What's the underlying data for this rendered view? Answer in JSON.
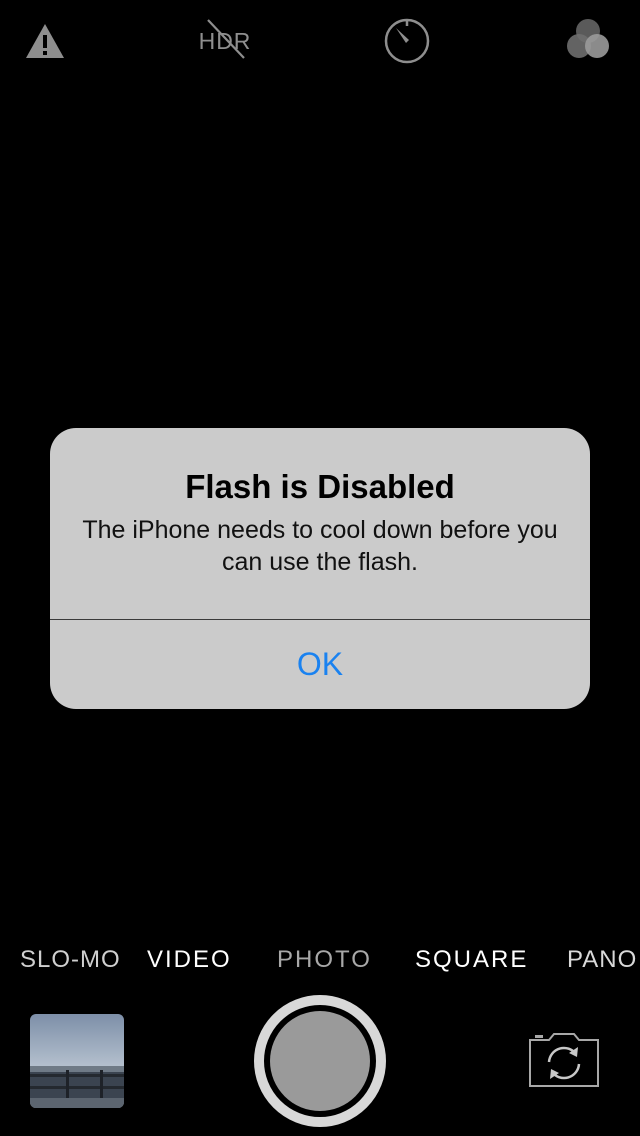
{
  "top_bar": {
    "hdr_label": "HDR",
    "icons": [
      "warning-icon",
      "hdr-off-icon",
      "timer-icon",
      "filters-icon"
    ]
  },
  "alert": {
    "title": "Flash is Disabled",
    "message": "The iPhone needs to cool down before you can use the flash.",
    "button_label": "OK",
    "button_color": "#1a82f0",
    "background_color": "#cbcbcb"
  },
  "modes": {
    "items": [
      "SLO-MO",
      "VIDEO",
      "PHOTO",
      "SQUARE",
      "PANO"
    ],
    "selected": "PHOTO"
  },
  "bottom": {
    "icons": [
      "last-photo-thumbnail",
      "shutter-button",
      "switch-camera-icon"
    ]
  },
  "colors": {
    "background": "#000000",
    "icon_gray": "#8e8e8e"
  }
}
